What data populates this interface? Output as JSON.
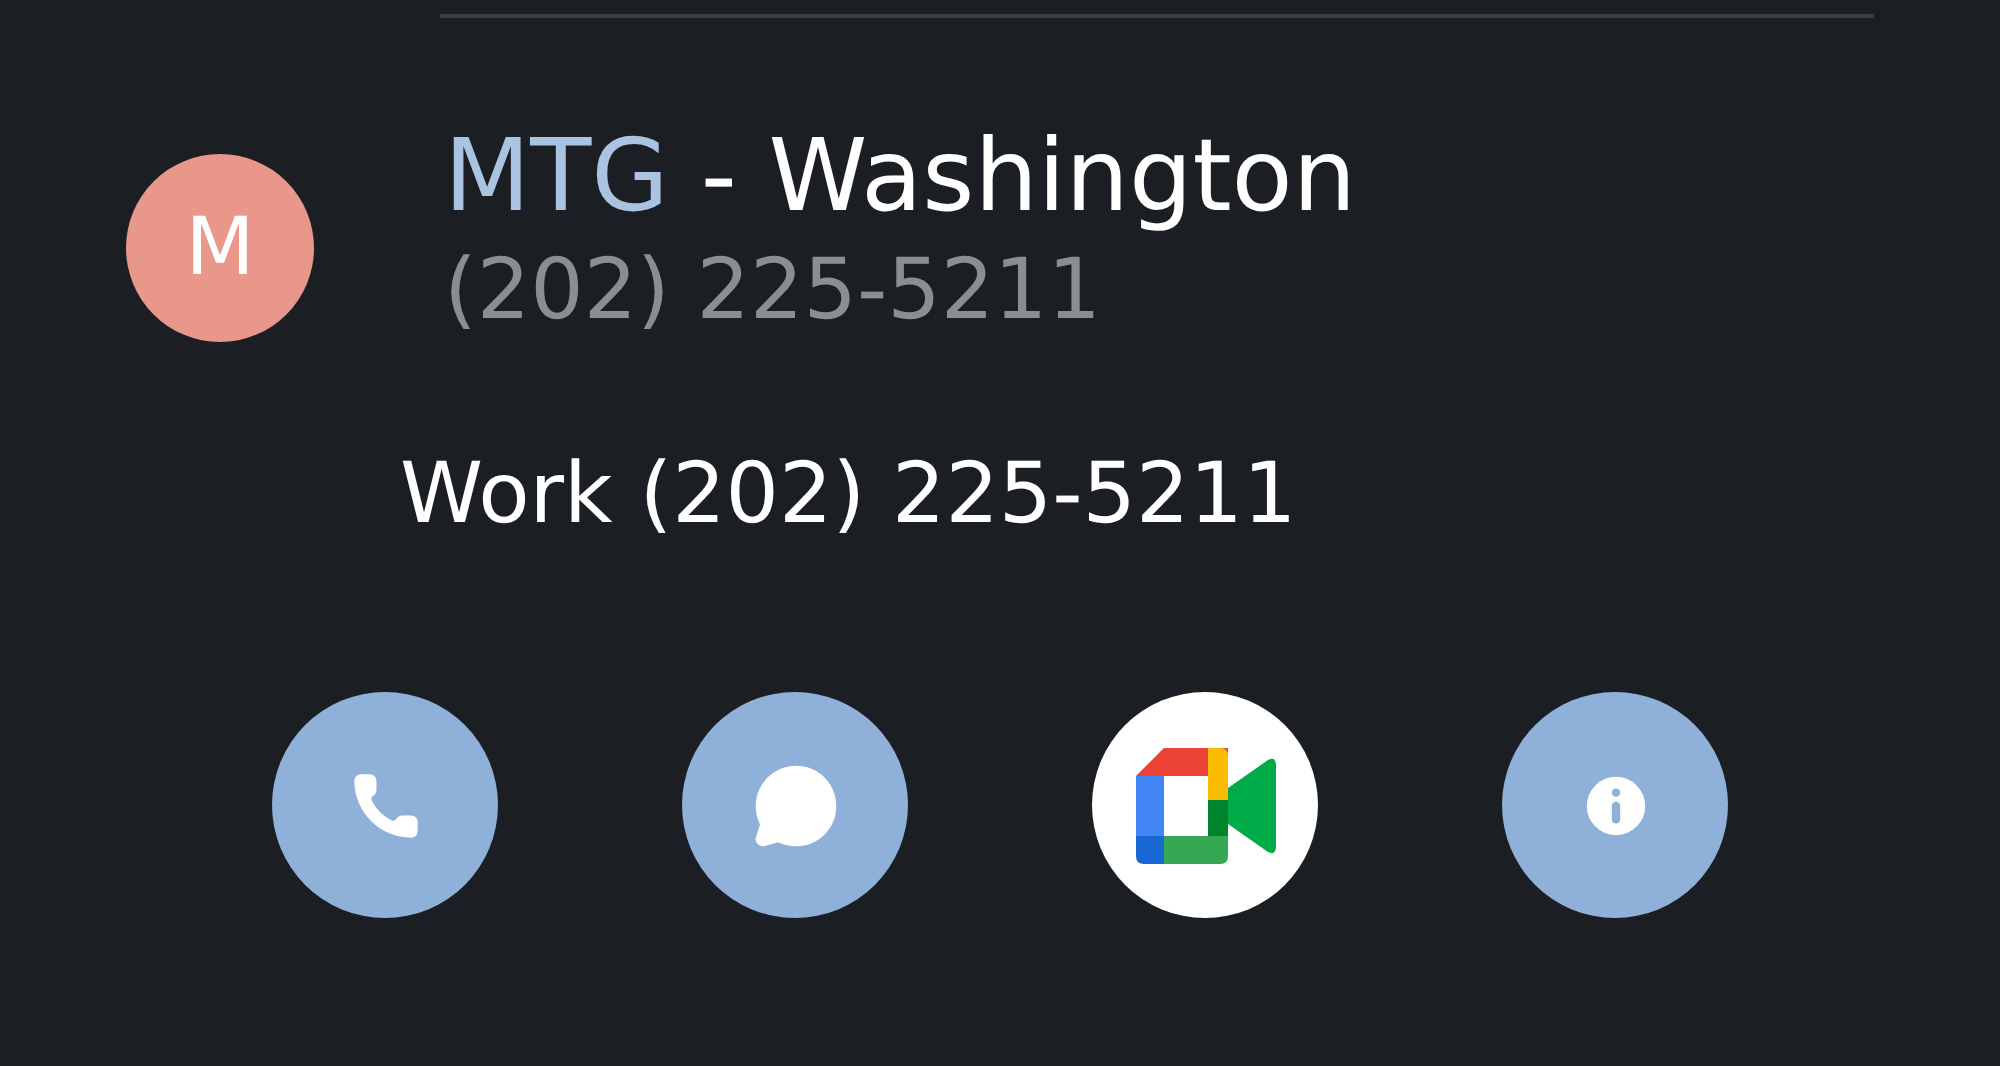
{
  "contact": {
    "avatar_letter": "M",
    "name_match": "MTG",
    "name_rest": " - Washington",
    "phone": "(202) 225-5211"
  },
  "number_line": "Work (202) 225-5211",
  "actions": [
    {
      "kind": "call"
    },
    {
      "kind": "message"
    },
    {
      "kind": "video"
    },
    {
      "kind": "info"
    }
  ]
}
